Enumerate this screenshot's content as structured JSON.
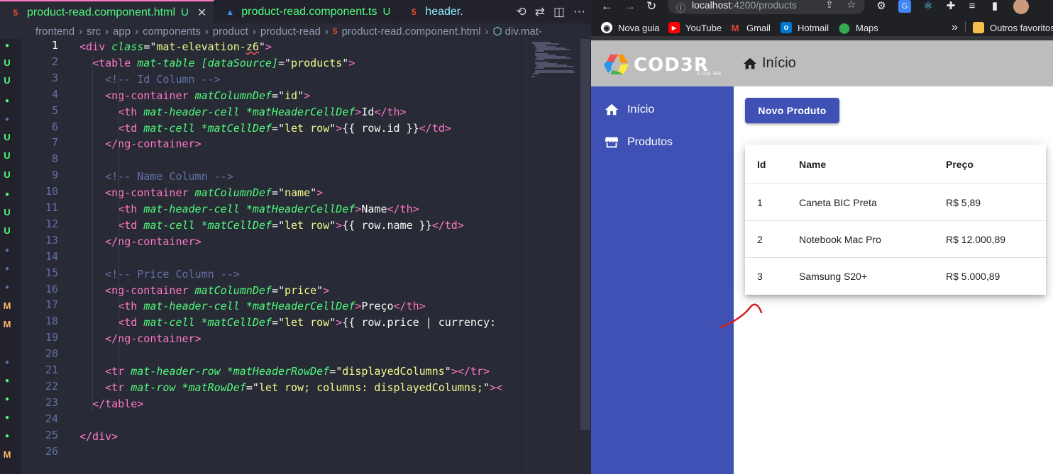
{
  "editor": {
    "tabs": [
      {
        "label": "product-read.component.html",
        "mark": "U",
        "type": "html"
      },
      {
        "label": "product-read.component.ts",
        "mark": "U",
        "type": "ts"
      },
      {
        "label": "header.",
        "mark": "",
        "type": "html"
      }
    ],
    "breadcrumb": [
      "frontend",
      "src",
      "app",
      "components",
      "product",
      "product-read",
      "product-read.component.html",
      "div.mat-"
    ],
    "code_lines": [
      "<div class=\"mat-elevation-z6\">",
      "  <table mat-table [dataSource]=\"products\">",
      "    <!-- Id Column -->",
      "    <ng-container matColumnDef=\"id\">",
      "      <th mat-header-cell *matHeaderCellDef>Id</th>",
      "      <td mat-cell *matCellDef=\"let row\">{{ row.id }}</td>",
      "    </ng-container>",
      "",
      "    <!-- Name Column -->",
      "    <ng-container matColumnDef=\"name\">",
      "      <th mat-header-cell *matHeaderCellDef>Name</th>",
      "      <td mat-cell *matCellDef=\"let row\">{{ row.name }}</td>",
      "    </ng-container>",
      "",
      "    <!-- Price Column -->",
      "    <ng-container matColumnDef=\"price\">",
      "      <th mat-header-cell *matHeaderCellDef>Preço</th>",
      "      <td mat-cell *matCellDef=\"let row\">{{ row.price | currency:",
      "    </ng-container>",
      "",
      "    <tr mat-header-row *matHeaderRowDef=\"displayedColumns\"></tr>",
      "    <tr mat-row *matRowDef=\"let row; columns: displayedColumns;\"><",
      "  </table>",
      "",
      "</div>",
      ""
    ],
    "current_line": 1
  },
  "browser": {
    "url_host": "localhost",
    "url_path": ":4200/products",
    "bookmarks": [
      {
        "label": "Nova guia",
        "icon": "globe-icon"
      },
      {
        "label": "YouTube",
        "icon": "youtube-icon"
      },
      {
        "label": "Gmail",
        "icon": "gmail-icon"
      },
      {
        "label": "Hotmail",
        "icon": "outlook-icon"
      },
      {
        "label": "Maps",
        "icon": "maps-icon"
      },
      {
        "label": "Outros favoritos",
        "icon": "folder-icon"
      }
    ],
    "more_bookmarks": "»"
  },
  "app": {
    "logo_text": "COD3R",
    "logo_sub": "COM.BR",
    "header_title": "Início",
    "nav": [
      {
        "label": "Início",
        "icon": "home-icon"
      },
      {
        "label": "Produtos",
        "icon": "storefront-icon"
      }
    ],
    "new_button": "Novo Produto",
    "table": {
      "headers": [
        "Id",
        "Name",
        "Preço"
      ],
      "rows": [
        {
          "id": "1",
          "name": "Caneta BIC Preta",
          "price": "R$ 5,89"
        },
        {
          "id": "2",
          "name": "Notebook Mac Pro",
          "price": "R$ 12.000,89"
        },
        {
          "id": "3",
          "name": "Samsung S20+",
          "price": "R$ 5.000,89"
        }
      ]
    },
    "colors": {
      "primary": "#3f51b5",
      "header_bg": "#bdbdbd"
    }
  }
}
